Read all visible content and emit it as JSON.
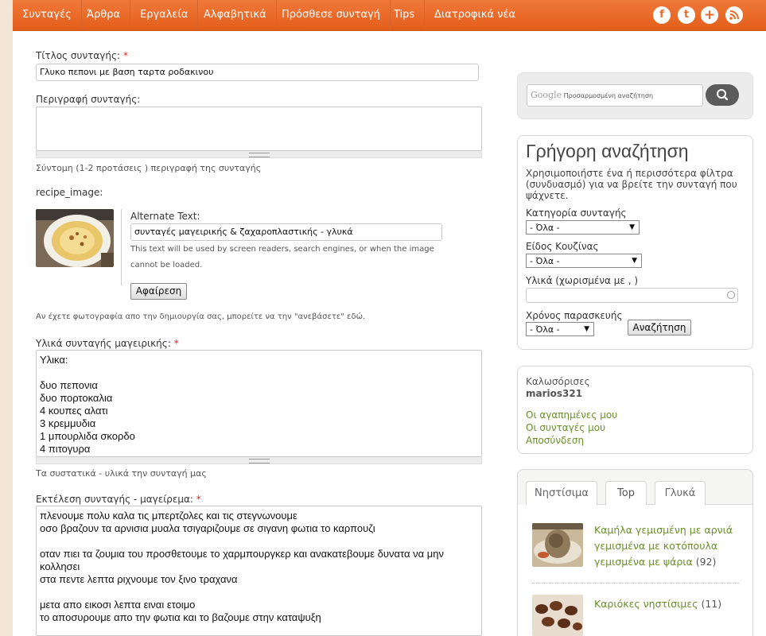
{
  "nav": {
    "items": [
      "Συνταγές",
      "Άρθρα",
      "Εργαλεία",
      "Αλφαβητικά",
      "Πρόσθεσε συνταγή",
      "Tips",
      "Διατροφικά νέα"
    ],
    "social": {
      "facebook": "f",
      "twitter": "t",
      "plus": "+",
      "rss": "rss"
    }
  },
  "form": {
    "title_label": "Τίτλος συνταγής:",
    "required_mark": "*",
    "title_value": "Γλυκο πεπονι με βαση ταρτα ροδακινου",
    "description_label": "Περιγραφή συνταγής:",
    "description_value": "",
    "description_help": "Σύντομη (1-2 προτάσεις ) περιγραφή της συνταγής",
    "image_label": "recipe_image:",
    "alt_label": "Alternate Text:",
    "alt_value": "συνταγές μαγειρικής & ζαχαροπλαστικής - γλυκά",
    "alt_help_1": "This text will be used by screen readers, search engines, or when the image",
    "alt_help_2": "cannot be loaded.",
    "remove_button": "Αφαίρεση",
    "image_help": "Αν έχετε φωτογραφία απο την δημιουργία σας, μπορείτε να την \"ανεβάσετε\" εδώ.",
    "ingredients_label": "Υλικά συνταγής μαγειρικής:",
    "ingredients_value": "Υλικα:\n\nδυο πεπονια\nδυο πορτοκαλια\n4 κουπες αλατι\n3 κρεμμυδια\n1 μπουρλιδα σκορδο\n4 πιτογυρα",
    "ingredients_help": "Τα συστατικά - υλικά την συνταγή μας",
    "method_label": "Εκτέλεση συνταγής - μαγείρεμα:",
    "method_value": "πλενουμε πολυ καλα τις μπερτζολες και τις στεγνωνουμε\nοσο βραζουν τα αρνισια μυαλα τσιγαριζουμε σε σιγανη φωτια το καρπουζι\n\nοταν πιει τα ζουμια του προσθετουμε το χαρμπουργκερ και ανακατεβουμε δυνατα να μην\nκολλησει\nστα πεντε λεπτα ριχνουμε τον ξινο τραχανα\n\nμετα απο εικοσι λεπτα ειναι ετοιμο\nτο αποσυρουμε απο την φωτια και το βαζουμε στην καταψυξη"
  },
  "sidebar": {
    "search": {
      "brand": "Google",
      "placeholder": "Προσαρμοσμένη αναζήτηση",
      "icon": "search-icon"
    },
    "quick": {
      "title": "Γρήγορη αναζήτηση",
      "description_1": "Χρησιμοποιήστε ένα ή περισσότερα φίλτρα",
      "description_2": "(συνδυασμό) για να βρείτε την συνταγή που",
      "description_3": "ψάχνετε.",
      "category_label": "Κατηγορία συνταγής",
      "category_value": "- Όλα -",
      "cuisine_label": "Είδος Κουζίνας",
      "cuisine_value": "- Όλα -",
      "ingredients_label": "Υλικά (χωρισμένα με , )",
      "ingredients_value": "",
      "time_label": "Χρόνος παρασκευής",
      "time_value": "- Όλα -",
      "submit": "Αναζήτηση"
    },
    "user": {
      "welcome": "Καλωσόρισες",
      "username": "marios321",
      "links": [
        "Οι αγαπημένες μου",
        "Οι συνταγές μου",
        "Αποσύνδεση"
      ]
    },
    "tabs": [
      "Νηστίσιμα",
      "Top",
      "Γλυκά"
    ],
    "top_items": [
      {
        "line1": "Καμήλα γεμισμένη με αρνιά",
        "line2": "γεμισμένα με κοτόπουλα",
        "line3": "γεμισμένα με ψάρια",
        "count": "(92)"
      },
      {
        "line1": "Καριόκες νηστίσιμες",
        "count": "(11)"
      }
    ]
  }
}
